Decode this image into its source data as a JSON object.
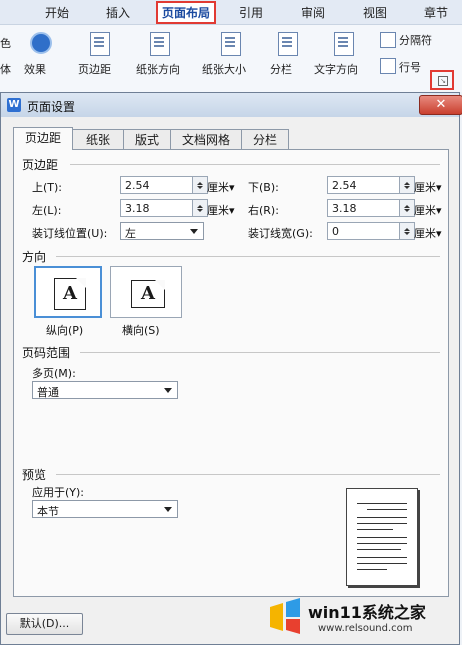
{
  "ribbon": {
    "menus": [
      "开始",
      "插入",
      "页面布局",
      "引用",
      "审阅",
      "视图",
      "章节"
    ],
    "active_menu": "页面布局",
    "left_cut1": "色",
    "left_cut2": "体",
    "effect": "效果",
    "buttons": [
      "页边距",
      "纸张方向",
      "纸张大小",
      "分栏",
      "文字方向"
    ],
    "separator_label": "分隔符",
    "line_number_label": "行号"
  },
  "dialog": {
    "app_icon": "W",
    "title": "页面设置",
    "tabs": [
      "页边距",
      "纸张",
      "版式",
      "文档网格",
      "分栏"
    ],
    "margins": {
      "section": "页边距",
      "top_label": "上(T):",
      "top_value": "2.54",
      "bottom_label": "下(B):",
      "bottom_value": "2.54",
      "left_label": "左(L):",
      "left_value": "3.18",
      "right_label": "右(R):",
      "right_value": "3.18",
      "gutter_pos_label": "装订线位置(U):",
      "gutter_pos_value": "左",
      "gutter_width_label": "装订线宽(G):",
      "gutter_width_value": "0",
      "unit": "厘米"
    },
    "orientation": {
      "section": "方向",
      "portrait": "纵向(P)",
      "landscape": "横向(S)",
      "glyph": "A"
    },
    "page_range": {
      "section": "页码范围",
      "multi_label": "多页(M):",
      "multi_value": "普通"
    },
    "preview": {
      "section": "预览",
      "apply_label": "应用于(Y):",
      "apply_value": "本节"
    },
    "default_button": "默认(D)..."
  },
  "watermark": {
    "text": "win11系统之家",
    "url": "www.relsound.com"
  },
  "colors": {
    "highlight": "#e13a33",
    "accent": "#2e6fd1"
  }
}
